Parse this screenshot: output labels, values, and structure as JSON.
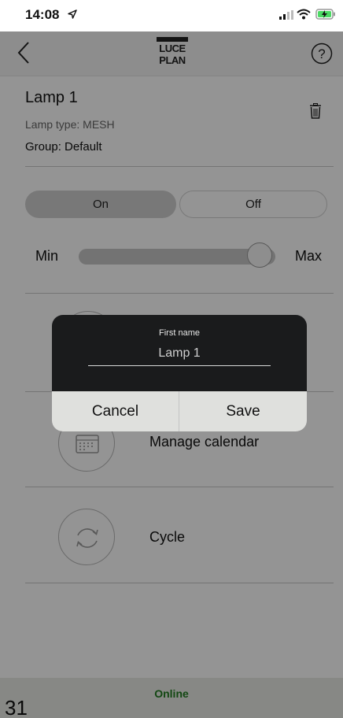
{
  "status_bar": {
    "time": "14:08"
  },
  "header": {
    "logo_line1": "LUCE",
    "logo_line2": "PLAN"
  },
  "lamp": {
    "name": "Lamp 1",
    "type": "Lamp type: MESH",
    "group": "Group: Default"
  },
  "power": {
    "on_label": "On",
    "off_label": "Off",
    "selected": "On"
  },
  "dimmer": {
    "min_label": "Min",
    "max_label": "Max",
    "level_fraction": 0.92
  },
  "menu": [
    {
      "label": "Manage calendar",
      "icon": "calendar-icon"
    },
    {
      "label": "Cycle",
      "icon": "cycle-icon"
    }
  ],
  "footer": {
    "status": "Online",
    "page_number": "31"
  },
  "dialog": {
    "field_label": "First name",
    "field_value": "Lamp 1",
    "cancel_label": "Cancel",
    "save_label": "Save"
  },
  "colors": {
    "online_text": "#1f7a1f",
    "dialog_body": "#1a1b1c",
    "dialog_actions": "#dfe0dd"
  }
}
